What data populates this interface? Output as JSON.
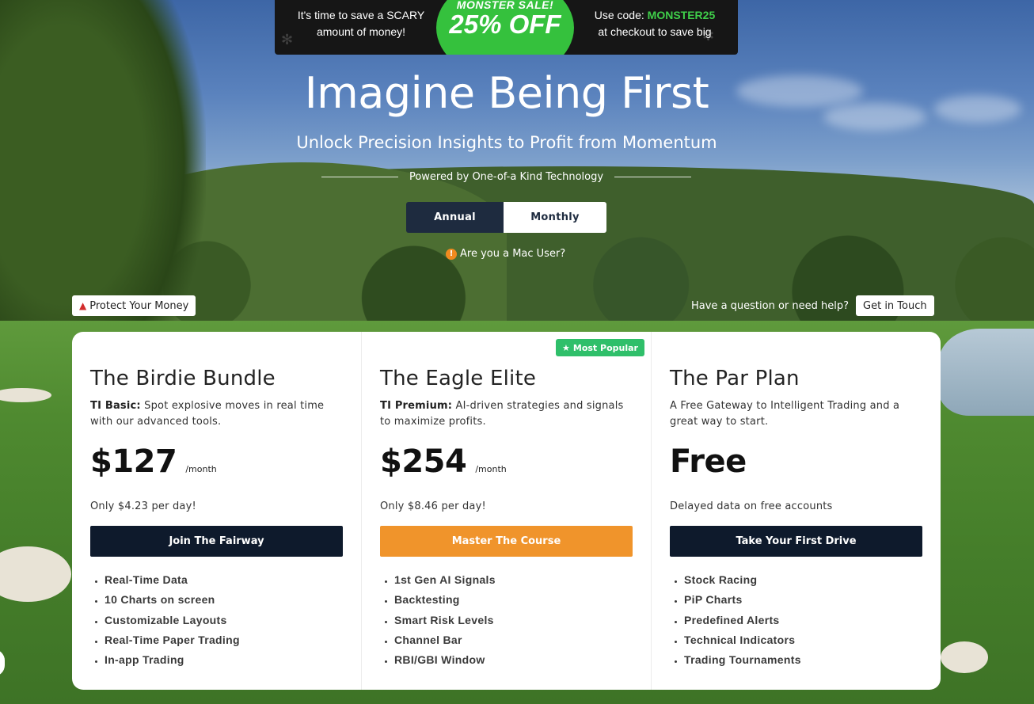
{
  "banner": {
    "left_line1": "It's time to save a SCARY",
    "left_line2": "amount of money!",
    "badge_line1": "MONSTER SALE!",
    "badge_line2": "25% OFF",
    "right_prefix": "Use code: ",
    "right_code": "MONSTER25",
    "right_line2": "at checkout to save big",
    "colors": {
      "background": "#161616",
      "badge": "#35c13d",
      "code": "#3fcf4a"
    }
  },
  "hero": {
    "title": "Imagine Being First",
    "subtitle": "Unlock Precision Insights to Profit from Momentum",
    "powered_by": "Powered by One-of-a Kind Technology"
  },
  "billing_toggle": {
    "annual_label": "Annual",
    "monthly_label": "Monthly",
    "selected": "Annual"
  },
  "mac_link": {
    "icon": "info-icon",
    "label": "Are you a Mac User?"
  },
  "protect": {
    "icon": "warning-icon",
    "label": "Protect Your Money"
  },
  "help": {
    "text": "Have a question or need help?",
    "button_label": "Get in Touch"
  },
  "plans": [
    {
      "name": "The Birdie Bundle",
      "tier_label": "TI Basic:",
      "description": " Spot explosive moves in real time with our advanced tools.",
      "price": "$127",
      "period": "/month",
      "per_day": "Only $4.23 per day!",
      "cta_label": "Join The Fairway",
      "cta_color": "#0e1a2c",
      "features": [
        "Real-Time Data",
        "10 Charts on screen",
        "Customizable Layouts",
        "Real-Time Paper Trading",
        "In-app Trading"
      ]
    },
    {
      "name": "The Eagle Elite",
      "badge": "Most Popular",
      "badge_icon": "star-icon",
      "badge_color": "#2fbf6a",
      "tier_label": "TI Premium:",
      "description": " AI-driven strategies and signals to maximize profits.",
      "price": "$254",
      "period": "/month",
      "per_day": "Only $8.46 per day!",
      "cta_label": "Master The Course",
      "cta_color": "#f0942b",
      "features": [
        "1st Gen AI Signals",
        "Backtesting",
        "Smart Risk Levels",
        "Channel Bar",
        "RBI/GBI Window"
      ]
    },
    {
      "name": "The Par Plan",
      "tier_label": "",
      "description": "A Free Gateway to Intelligent Trading and a great way to start.",
      "price": "Free",
      "period": "",
      "per_day": "Delayed data on free accounts",
      "cta_label": "Take Your First Drive",
      "cta_color": "#0e1a2c",
      "features": [
        "Stock Racing",
        "PiP Charts",
        "Predefined Alerts",
        "Technical Indicators",
        "Trading Tournaments"
      ]
    }
  ]
}
